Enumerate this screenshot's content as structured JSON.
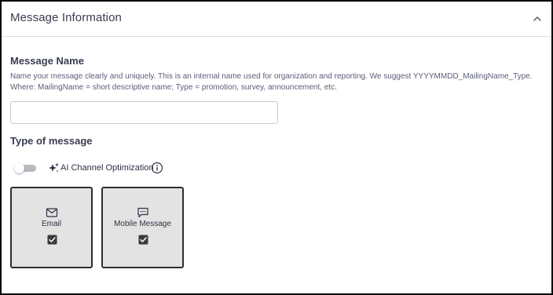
{
  "header": {
    "title": "Message Information",
    "collapse_icon": "chevron-up-icon"
  },
  "message_name": {
    "label": "Message Name",
    "help_text": "Name your message clearly and uniquely. This is an internal name used for organization and reporting. We suggest YYYYMMDD_MailingName_Type. Where: MailingName = short descriptive name; Type = promotion, survey, announcement, etc.",
    "value": "",
    "placeholder": ""
  },
  "type_of_message": {
    "label": "Type of message",
    "ai_toggle": {
      "label": "AI Channel Optimization",
      "enabled": false,
      "icon": "sparkle-icon",
      "info_icon": "info-icon"
    },
    "channels": [
      {
        "label": "Email",
        "icon": "envelope-icon",
        "checked": true
      },
      {
        "label": "Mobile Message",
        "icon": "chat-bubble-icon",
        "checked": true
      }
    ]
  },
  "colors": {
    "card_background": "#e3e3e3",
    "card_border": "#2e2e2e",
    "text": "#2f3142",
    "toggle_off": "#b8b9c2"
  }
}
